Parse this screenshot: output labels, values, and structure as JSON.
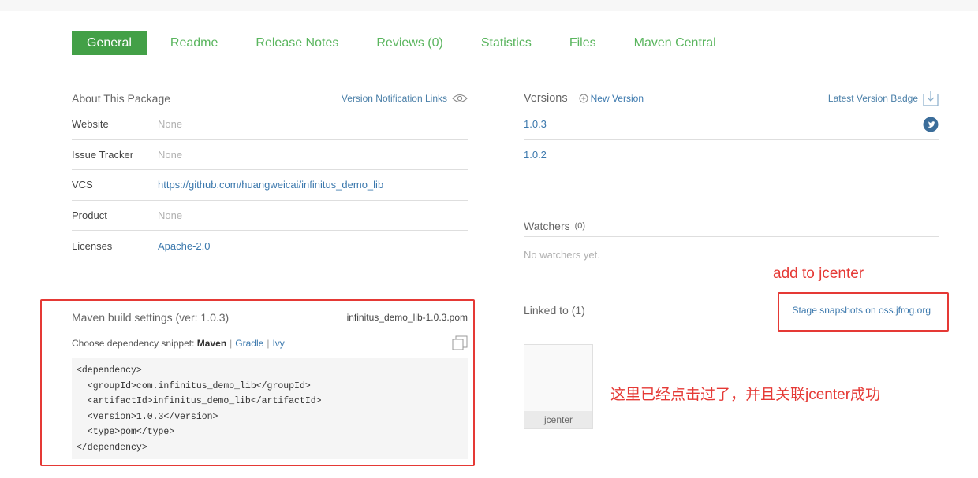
{
  "tabs": [
    "General",
    "Readme",
    "Release Notes",
    "Reviews (0)",
    "Statistics",
    "Files",
    "Maven Central"
  ],
  "about": {
    "title": "About This Package",
    "notification_link": "Version Notification Links",
    "rows": [
      {
        "label": "Website",
        "value": "None"
      },
      {
        "label": "Issue Tracker",
        "value": "None"
      },
      {
        "label": "VCS",
        "value": "https://github.com/huangweicai/infinitus_demo_lib"
      },
      {
        "label": "Product",
        "value": "None"
      },
      {
        "label": "Licenses",
        "value": "Apache-2.0"
      }
    ]
  },
  "maven": {
    "title": "Maven build settings (ver: 1.0.3)",
    "file": "infinitus_demo_lib-1.0.3.pom",
    "choose_label": "Choose dependency snippet:",
    "selected": "Maven",
    "options": [
      "Gradle",
      "Ivy"
    ],
    "code": "<dependency>\n  <groupId>com.infinitus_demo_lib</groupId>\n  <artifactId>infinitus_demo_lib</artifactId>\n  <version>1.0.3</version>\n  <type>pom</type>\n</dependency>"
  },
  "versions": {
    "title": "Versions",
    "new_version": "New Version",
    "badge": "Latest Version Badge",
    "items": [
      "1.0.3",
      "1.0.2"
    ]
  },
  "watchers": {
    "title": "Watchers",
    "count": "(0)",
    "empty": "No watchers yet."
  },
  "linked": {
    "title": "Linked to (1)",
    "stage_link": "Stage snapshots on oss.jfrog.org",
    "repo": "jcenter"
  },
  "annotations": {
    "add_to_jcenter": "add to jcenter",
    "note": "这里已经点击过了，并且关联jcenter成功",
    "color": "#e53935"
  },
  "colors": {
    "tab_active_bg": "#43a047",
    "tab_text": "#5ab55e",
    "link": "#3b78ad"
  }
}
